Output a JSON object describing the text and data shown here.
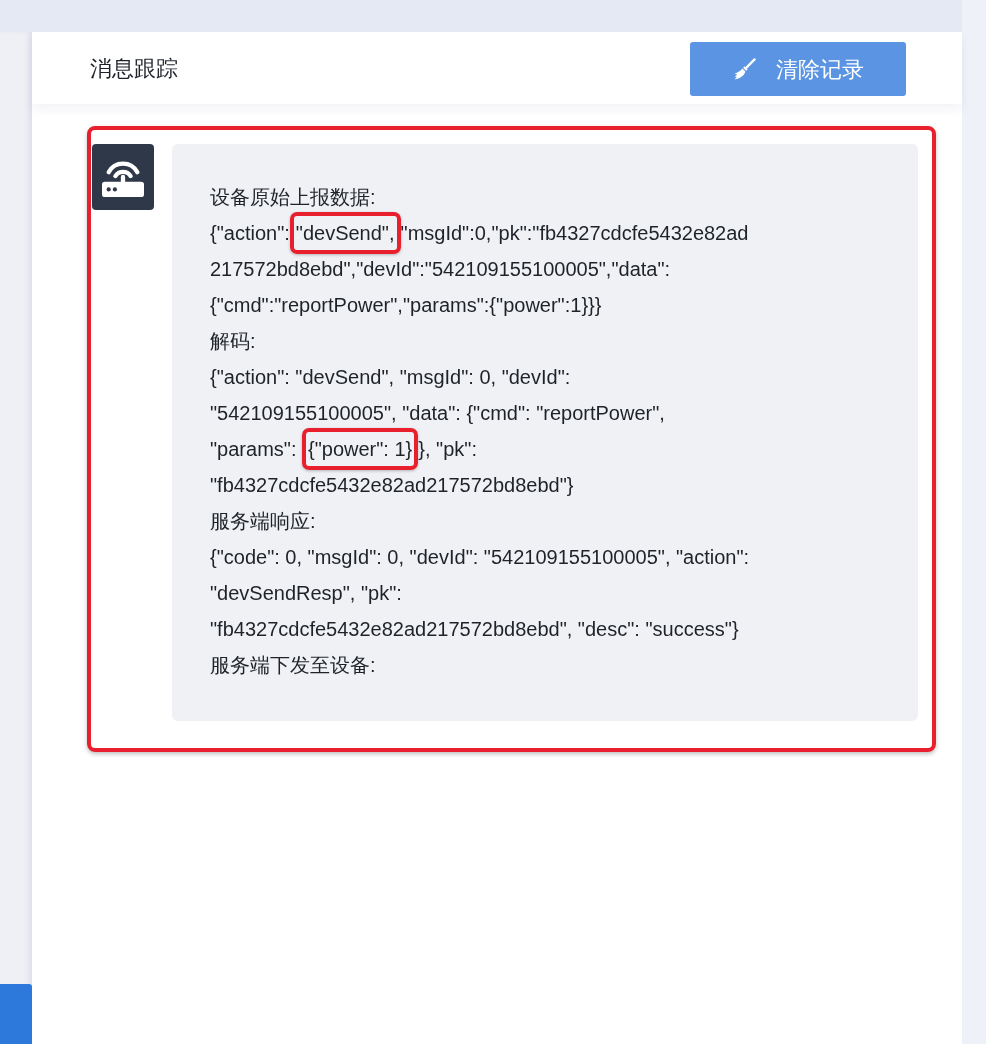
{
  "panel": {
    "title": "消息跟踪",
    "clear_button": {
      "label": "清除记录"
    }
  },
  "message": {
    "highlighted": true,
    "blocks": [
      {
        "lines": [
          [
            {
              "text": "设备原始上报数据:"
            }
          ]
        ]
      },
      {
        "lines": [
          [
            {
              "text": "{\"action\":"
            },
            {
              "text": "\"devSend\",",
              "highlighted": true
            },
            {
              "text": "\"msgId\":0,\"pk\":\"fb4327cdcfe5432e82ad"
            }
          ],
          [
            {
              "text": "217572bd8ebd\",\"devId\":\"542109155100005\",\"data\":"
            }
          ],
          [
            {
              "text": "{\"cmd\":\"reportPower\",\"params\":{\"power\":1}}}"
            }
          ]
        ]
      },
      {
        "lines": [
          [
            {
              "text": "解码:"
            }
          ]
        ]
      },
      {
        "lines": [
          [
            {
              "text": "{\"action\": \"devSend\", \"msgId\": 0, \"devId\":"
            }
          ],
          [
            {
              "text": "\"542109155100005\", \"data\": {\"cmd\": \"reportPower\","
            }
          ],
          [
            {
              "text": "\"params\": "
            },
            {
              "text": "{\"power\": 1}",
              "highlighted": true
            },
            {
              "text": "}, \"pk\":"
            }
          ],
          [
            {
              "text": "\"fb4327cdcfe5432e82ad217572bd8ebd\"}"
            }
          ]
        ]
      },
      {
        "lines": [
          [
            {
              "text": "服务端响应:"
            }
          ]
        ]
      },
      {
        "lines": [
          [
            {
              "text": "{\"code\": 0, \"msgId\": 0, \"devId\": \"542109155100005\", \"action\":"
            }
          ],
          [
            {
              "text": "\"devSendResp\", \"pk\":"
            }
          ],
          [
            {
              "text": "\"fb4327cdcfe5432e82ad217572bd8ebd\", \"desc\": \"success\"}"
            }
          ]
        ]
      },
      {
        "lines": [
          [
            {
              "text": "服务端下发至设备:"
            }
          ]
        ]
      }
    ]
  }
}
